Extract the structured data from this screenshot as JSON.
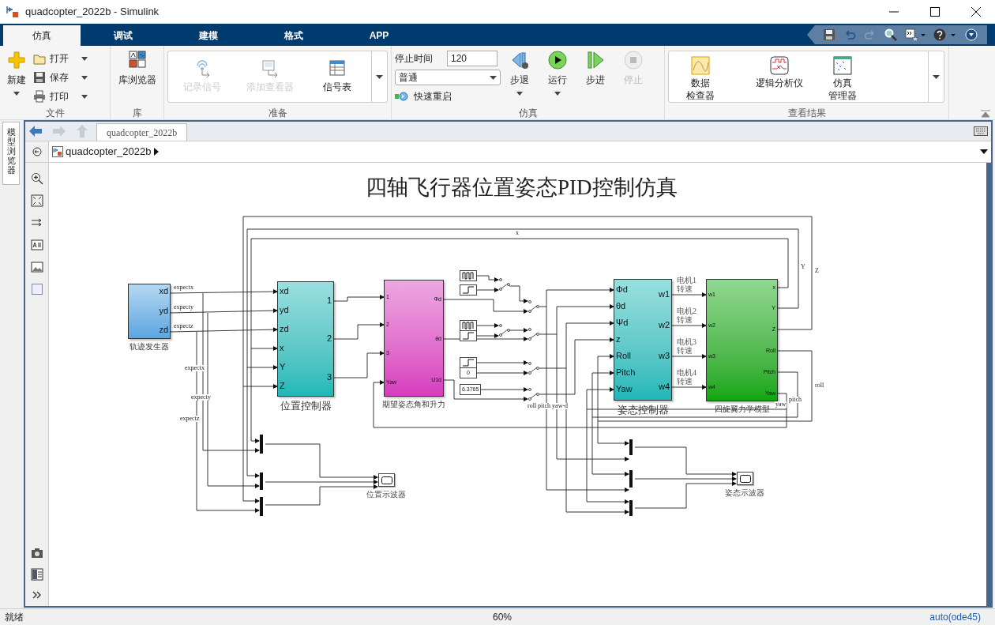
{
  "window": {
    "title": "quadcopter_2022b - Simulink"
  },
  "ribbon_tabs": [
    {
      "label": "仿真",
      "selected": true
    },
    {
      "label": "调试",
      "selected": false
    },
    {
      "label": "建模",
      "selected": false
    },
    {
      "label": "格式",
      "selected": false
    },
    {
      "label": "APP",
      "selected": false
    }
  ],
  "file_group": {
    "label": "文件",
    "new": "新建",
    "items": [
      "打开",
      "保存",
      "打印"
    ]
  },
  "library_group": {
    "label": "库",
    "button": "库浏览器"
  },
  "prepare_group": {
    "label": "准备",
    "buttons": [
      {
        "label": "记录信号",
        "disabled": true
      },
      {
        "label": "添加查看器",
        "disabled": true
      },
      {
        "label": "信号表",
        "disabled": false
      }
    ]
  },
  "simulate_group": {
    "label": "仿真",
    "stop_time_label": "停止时间",
    "stop_time": "120",
    "mode": "普通",
    "fast_restart": "快速重启",
    "buttons": [
      {
        "label": "步退",
        "disabled": false
      },
      {
        "label": "运行",
        "disabled": false
      },
      {
        "label": "步进",
        "disabled": false
      },
      {
        "label": "停止",
        "disabled": true
      }
    ]
  },
  "review_group": {
    "label": "查看结果",
    "buttons": [
      [
        "数据",
        "检查器"
      ],
      [
        "逻辑分析仪"
      ],
      [
        "仿真",
        "管理器"
      ]
    ]
  },
  "side_tab": "模型浏览器",
  "editor_tab": "quadcopter_2022b",
  "breadcrumb": "quadcopter_2022b",
  "diagram": {
    "title": "四轴飞行器位置姿态PID控制仿真",
    "blocks": [
      {
        "name": "轨迹发生器",
        "color": "#5aa6e0",
        "outputs": [
          "xd",
          "yd",
          "zd"
        ]
      },
      {
        "name": "位置控制器",
        "color": "#1bb8b8",
        "inputs": [
          "xd",
          "yd",
          "zd",
          "x",
          "Y",
          "Z"
        ],
        "outputs": [
          "1",
          "2",
          "3"
        ]
      },
      {
        "name": "期望姿态角和升力",
        "color": "#d63cbe",
        "inputs": [
          "1",
          "2",
          "3",
          "Yaw"
        ],
        "outputs": [
          "Φd",
          "θd",
          "U1d"
        ]
      },
      {
        "name": "姿态控制器",
        "color": "#1bb8b8",
        "inputs": [
          "Φd",
          "θd",
          "Ψd",
          "z",
          "Roll",
          "Pitch",
          "Yaw"
        ],
        "outputs": [
          "w1",
          "w2",
          "w3",
          "w4"
        ]
      },
      {
        "name": "四旋翼力学模型",
        "color": "#0aa60a",
        "inputs": [
          "w1",
          "w2",
          "w3",
          "w4"
        ],
        "outputs": [
          "x",
          "Y",
          "Z",
          "Roll",
          "Pitch",
          "Yaw"
        ]
      }
    ],
    "sources": [
      {
        "kind": "pulse"
      },
      {
        "kind": "step"
      },
      {
        "kind": "pulse"
      },
      {
        "kind": "step"
      },
      {
        "kind": "step"
      },
      {
        "kind": "constant",
        "value": "0"
      },
      {
        "kind": "constant",
        "value": "6.3765"
      }
    ],
    "signal_labels": [
      "expectx",
      "expecty",
      "expectz",
      "expectx",
      "expecty",
      "expectz",
      "x",
      "Y",
      "Z",
      "电机1转速",
      "电机2转速",
      "电机3转速",
      "电机4转速",
      "pitch",
      "roll",
      "yaw",
      "roll pitch yaw-d"
    ],
    "scopes": [
      {
        "name": "位置示波器"
      },
      {
        "name": "姿态示波器"
      }
    ]
  },
  "status_bar": {
    "status": "就绪",
    "zoom": "60%",
    "solver": "auto(ode45)"
  }
}
